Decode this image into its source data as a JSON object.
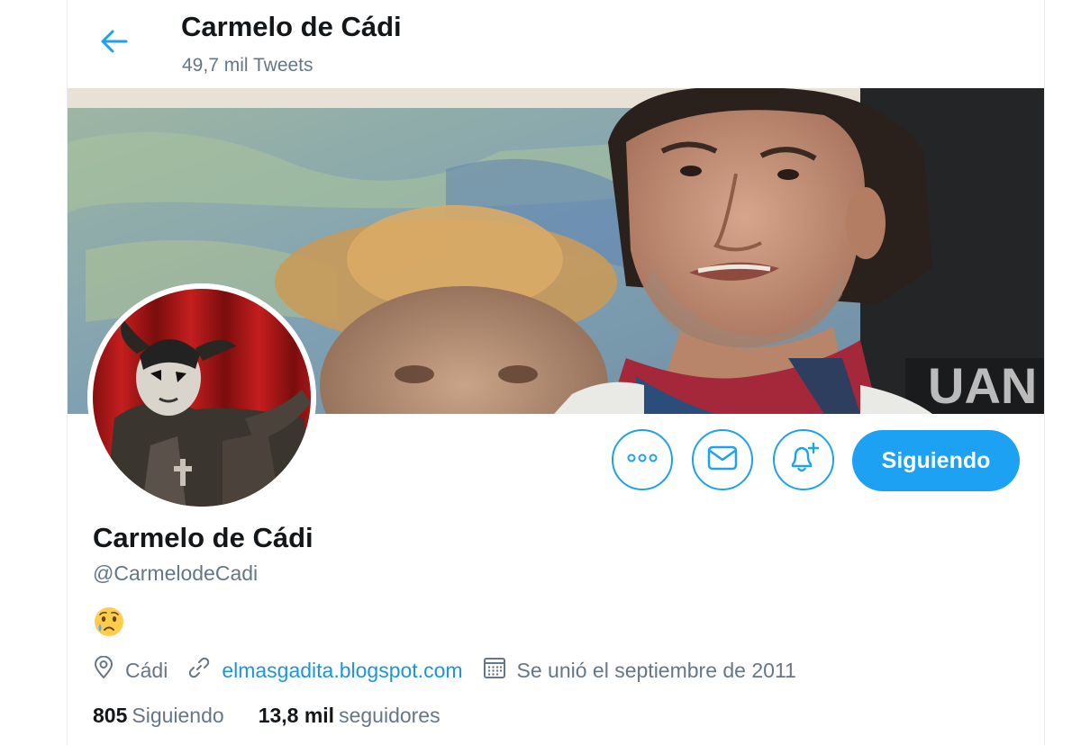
{
  "header": {
    "back_icon": "arrow-left-icon",
    "title": "Carmelo de Cádi",
    "tweet_count": "49,7 mil Tweets"
  },
  "banner": {
    "description_icon": "banner-photo"
  },
  "actions": {
    "more_icon": "more-horizontal-icon",
    "message_icon": "envelope-icon",
    "notify_icon": "bell-plus-icon",
    "follow_label": "Siguiendo"
  },
  "profile": {
    "name": "Carmelo de Cádi",
    "handle": "@CarmelodeCadi",
    "bio_emoji": "crying-face-emoji",
    "location": "Cádi",
    "website": "elmasgadita.blogspot.com",
    "joined": "Se unió el septiembre de 2011"
  },
  "stats": {
    "following_count": "805",
    "following_label": "Siguiendo",
    "followers_count": "13,8 mil",
    "followers_label": "seguidores"
  },
  "colors": {
    "accent": "#1da1f2",
    "link": "#1b95e0",
    "secondary_text": "#657786",
    "primary_text": "#14171a"
  }
}
